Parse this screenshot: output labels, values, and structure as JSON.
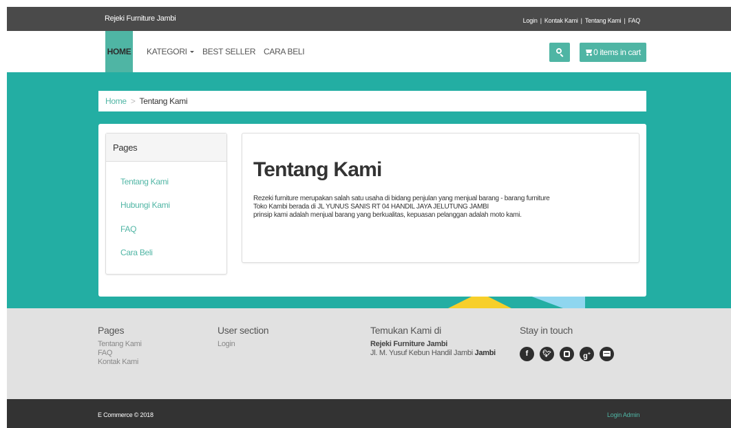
{
  "topbar": {
    "brand": "Rejeki Furniture Jambi",
    "links": [
      "Login",
      "Kontak Kami",
      "Tentang Kami",
      "FAQ"
    ],
    "separator": "|"
  },
  "nav": {
    "items": [
      {
        "label": "HOME",
        "active": true
      },
      {
        "label": "KATEGORI",
        "has_dropdown": true
      },
      {
        "label": "BEST SELLER"
      },
      {
        "label": "CARA BELI"
      }
    ],
    "search_icon": "search-icon",
    "cart_label": "0 items in cart",
    "cart_icon": "cart-icon",
    "accent_color": "#4fb5a4"
  },
  "breadcrumb": {
    "home": "Home",
    "separator": ">",
    "current": "Tentang Kami"
  },
  "sidebar": {
    "title": "Pages",
    "links": [
      "Tentang Kami",
      "Hubungi Kami",
      "FAQ",
      "Cara Beli"
    ]
  },
  "content": {
    "title": "Tentang Kami",
    "lines": [
      "Rezeki furniture merupakan salah satu usaha di bidang penjulan yang menjual barang - barang furniture",
      "Toko Kambi berada di JL YUNUS SANIS RT 04 HANDIL JAYA JELUTUNG JAMBI",
      "prinsip kami adalah menjual barang yang berkualitas, kepuasan pelanggan adalah moto kami."
    ]
  },
  "footer": {
    "pages": {
      "title": "Pages",
      "links": [
        "Tentang Kami",
        "FAQ",
        "Kontak Kami"
      ]
    },
    "user_section": {
      "title": "User section",
      "links": [
        "Login"
      ]
    },
    "find_us": {
      "title": "Temukan Kami di",
      "shop_name": "Rejeki Furniture Jambi",
      "address": "Jl. M. Yusuf Kebun Handil Jambi",
      "city": "Jambi"
    },
    "social": {
      "title": "Stay in touch",
      "icons": [
        "facebook-icon",
        "twitter-icon",
        "instagram-icon",
        "google-plus-icon",
        "email-icon"
      ]
    }
  },
  "bottombar": {
    "copyright": "E Commerce © 2018",
    "admin_link": "Login Admin"
  },
  "colors": {
    "teal_band": "#23aea3",
    "topbar": "#4a4a4a",
    "bottombar": "#333333",
    "footer": "#e1e1e1"
  }
}
